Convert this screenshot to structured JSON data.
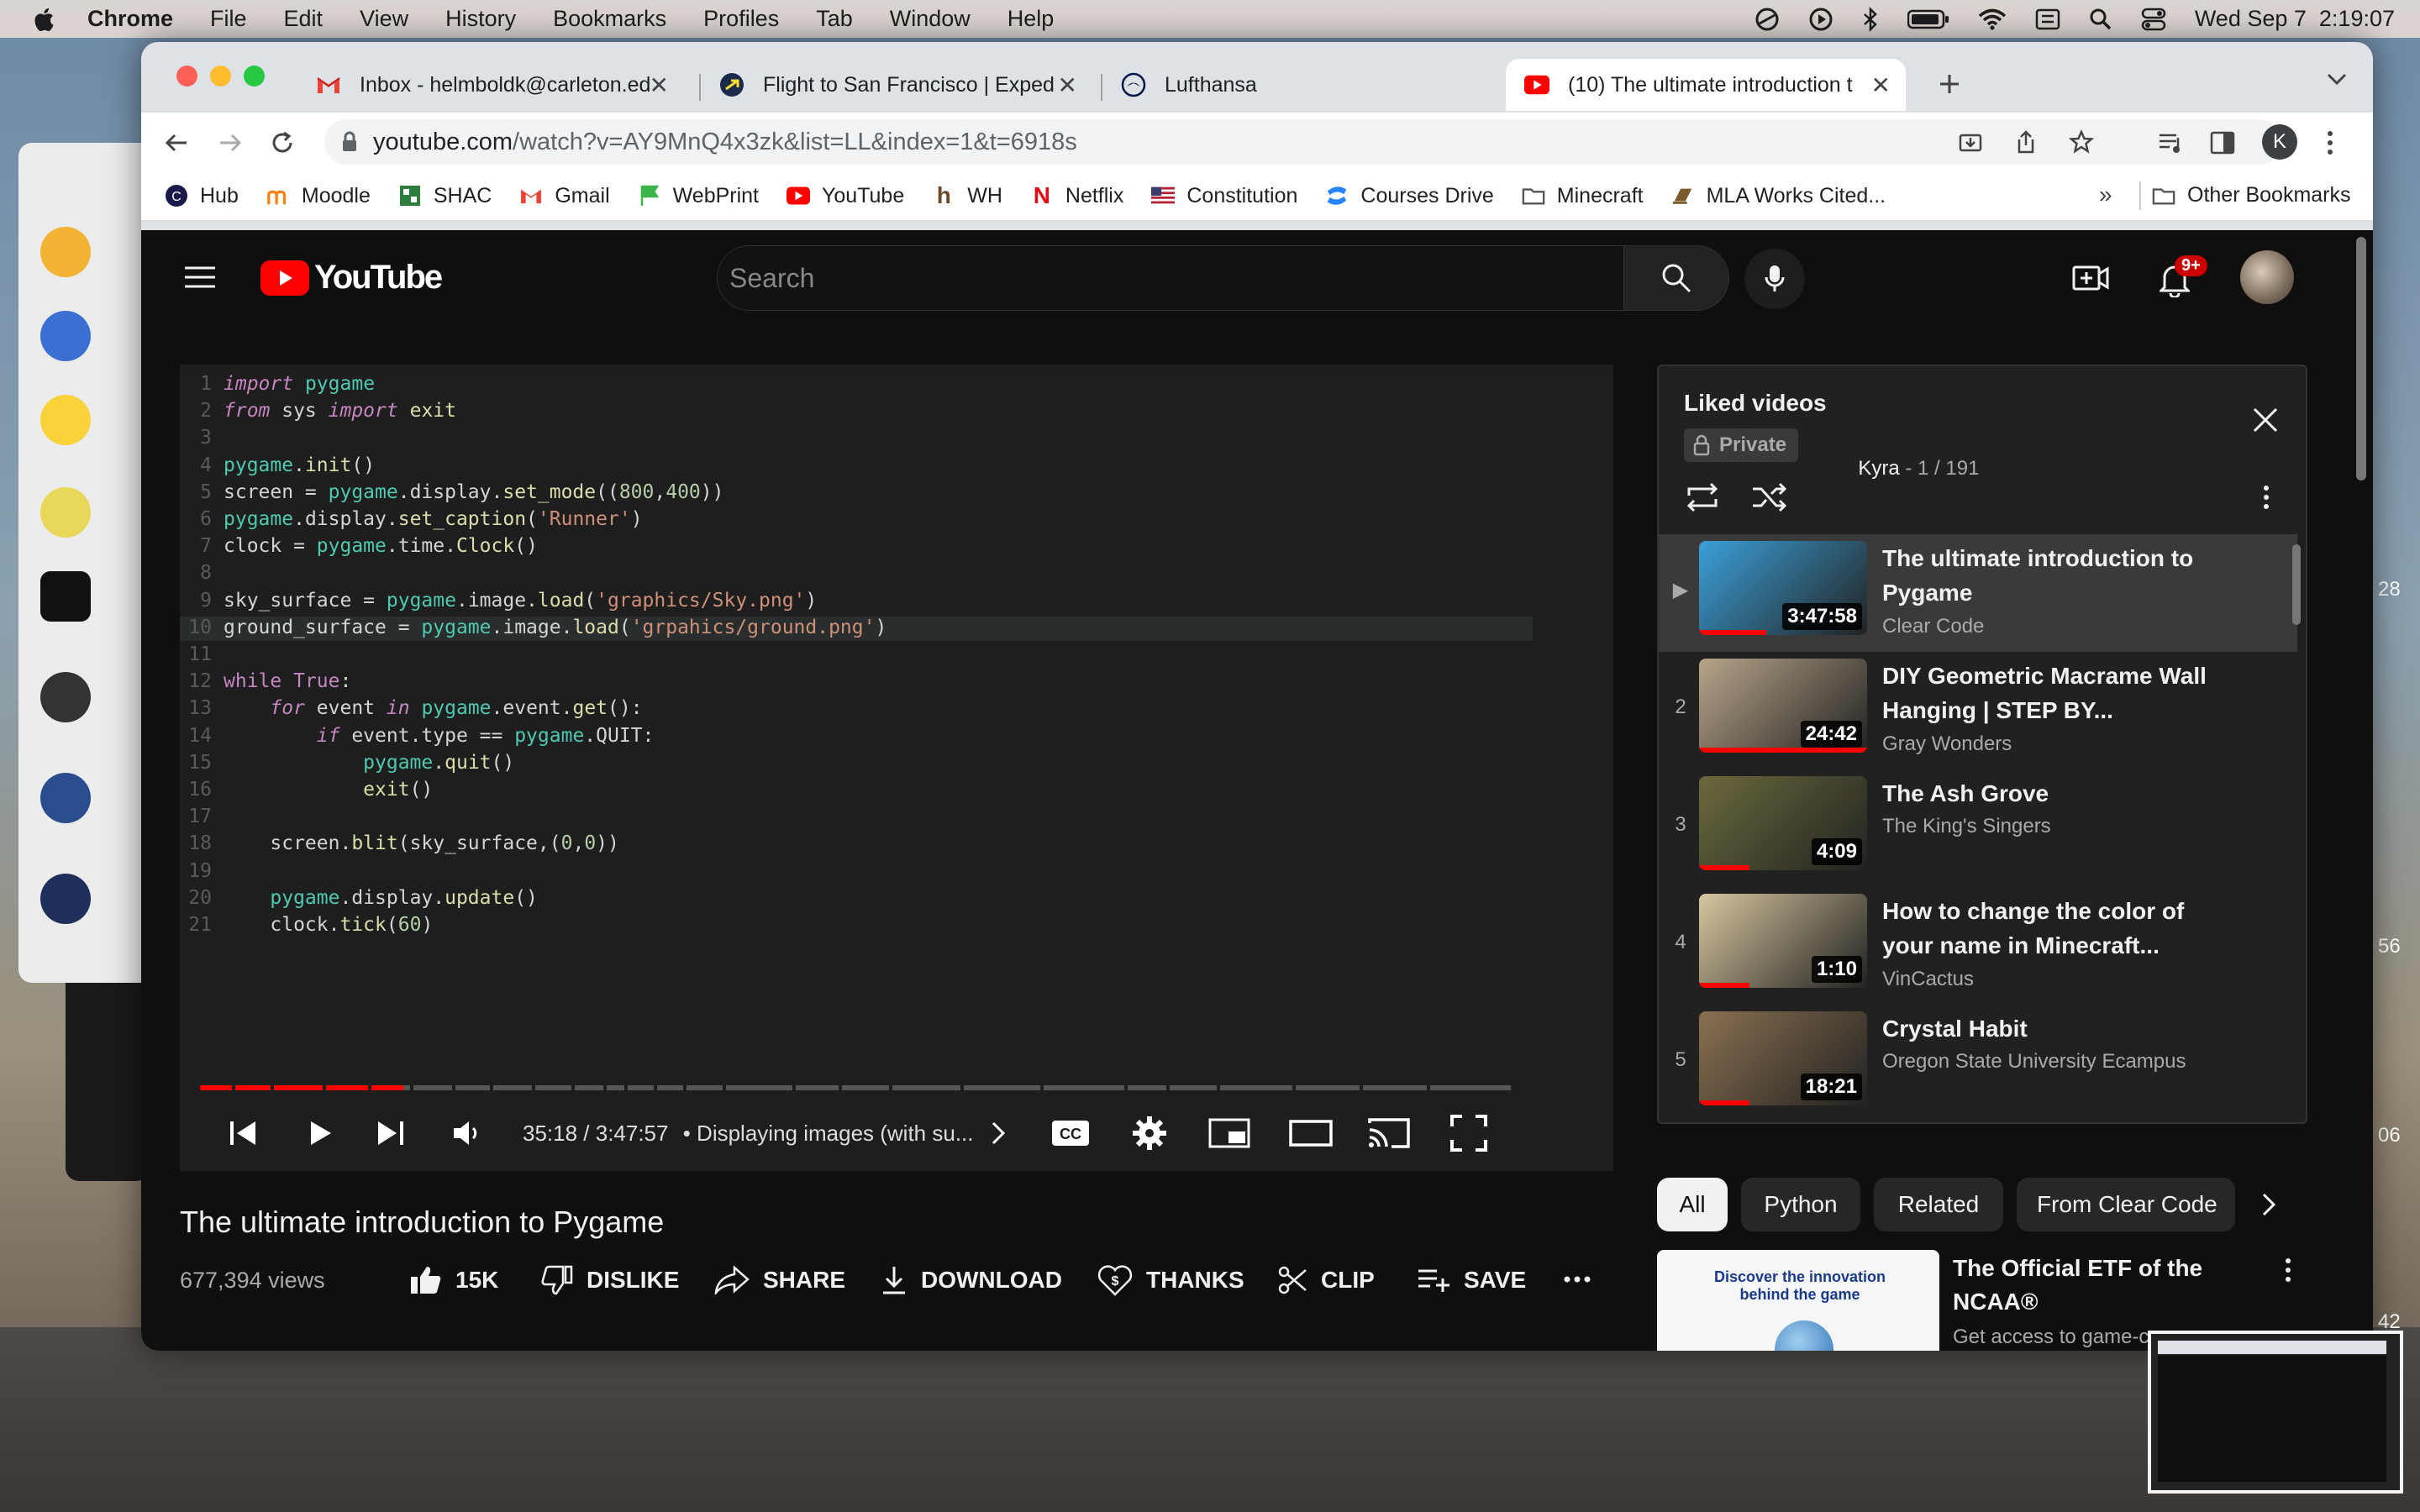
{
  "menubar": {
    "app": "Chrome",
    "items": [
      "File",
      "Edit",
      "View",
      "History",
      "Bookmarks",
      "Profiles",
      "Tab",
      "Window",
      "Help"
    ],
    "datetime": "Wed Sep 7  2:19:07"
  },
  "side_numbers": [
    "28",
    "56",
    "06",
    "42"
  ],
  "tabs": [
    {
      "title": "Inbox - helmboldk@carleton.ed",
      "icon": "gmail-icon"
    },
    {
      "title": "Flight to San Francisco | Exped",
      "icon": "expedia-icon"
    },
    {
      "title": "Lufthansa",
      "icon": "lufthansa-icon"
    },
    {
      "title": "(10) The ultimate introduction t",
      "icon": "youtube-icon",
      "active": true
    }
  ],
  "address": {
    "host": "youtube.com",
    "path": "/watch?v=AY9MnQ4x3zk&list=LL&index=1&t=6918s"
  },
  "profile_initial": "K",
  "bookmarks": [
    "Hub",
    "Moodle",
    "SHAC",
    "Gmail",
    "WebPrint",
    "YouTube",
    "WH",
    "Netflix",
    "Constitution",
    "Courses Drive",
    "Minecraft",
    "MLA Works Cited..."
  ],
  "bookmarks_more": "»",
  "other_bookmarks": "Other Bookmarks",
  "youtube": {
    "logo_text": "YouTube",
    "search_placeholder": "Search",
    "notification_count": "9+"
  },
  "code_lines": [
    "import pygame",
    "from sys import exit",
    "",
    "pygame.init()",
    "screen = pygame.display.set_mode((800,400))",
    "pygame.display.set_caption('Runner')",
    "clock = pygame.time.Clock()",
    "",
    "sky_surface = pygame.image.load('graphics/Sky.png')",
    "ground_surface = pygame.image.load('grpahics/ground.png')",
    "",
    "while True:",
    "    for event in pygame.event.get():",
    "        if event.type == pygame.QUIT:",
    "            pygame.quit()",
    "            exit()",
    "",
    "    screen.blit(sky_surface,(0,0))",
    "",
    "    pygame.display.update()",
    "    clock.tick(60)"
  ],
  "player": {
    "time": "35:18 / 3:47:57",
    "chapter": "• Displaying images (with su...",
    "progress": 0.155
  },
  "video": {
    "title": "The ultimate introduction to Pygame",
    "views": "677,394 views",
    "likes": "15K",
    "dislike_label": "DISLIKE",
    "share_label": "SHARE",
    "download_label": "DOWNLOAD",
    "thanks_label": "THANKS",
    "clip_label": "CLIP",
    "save_label": "SAVE"
  },
  "playlist": {
    "title": "Liked videos",
    "privacy": "Private",
    "owner": "Kyra",
    "position": " - 1 / 191",
    "items": [
      {
        "index": "▶",
        "title": "The ultimate introduction to Pygame",
        "channel": "Clear Code",
        "duration": "3:47:58",
        "thumb": "#3aa0d8"
      },
      {
        "index": "2",
        "title": "DIY Geometric Macrame Wall Hanging | STEP BY...",
        "channel": "Gray Wonders",
        "duration": "24:42",
        "thumb": "#b8a58a"
      },
      {
        "index": "3",
        "title": "The Ash Grove",
        "channel": "The King's Singers",
        "duration": "4:09",
        "thumb": "#6b6a3c"
      },
      {
        "index": "4",
        "title": "How to change the color of your name in Minecraft...",
        "channel": "VinCactus",
        "duration": "1:10",
        "thumb": "#d8c8a0"
      },
      {
        "index": "5",
        "title": "Crystal Habit",
        "channel": "Oregon State University Ecampus",
        "duration": "18:21",
        "thumb": "#8a7050"
      }
    ]
  },
  "chips": [
    "All",
    "Python",
    "Related",
    "From Clear Code"
  ],
  "ad": {
    "title": "The Official ETF of the NCAA®",
    "subtitle": "Get access to game-c",
    "thumb_text": "Discover the innovation behind the game"
  }
}
